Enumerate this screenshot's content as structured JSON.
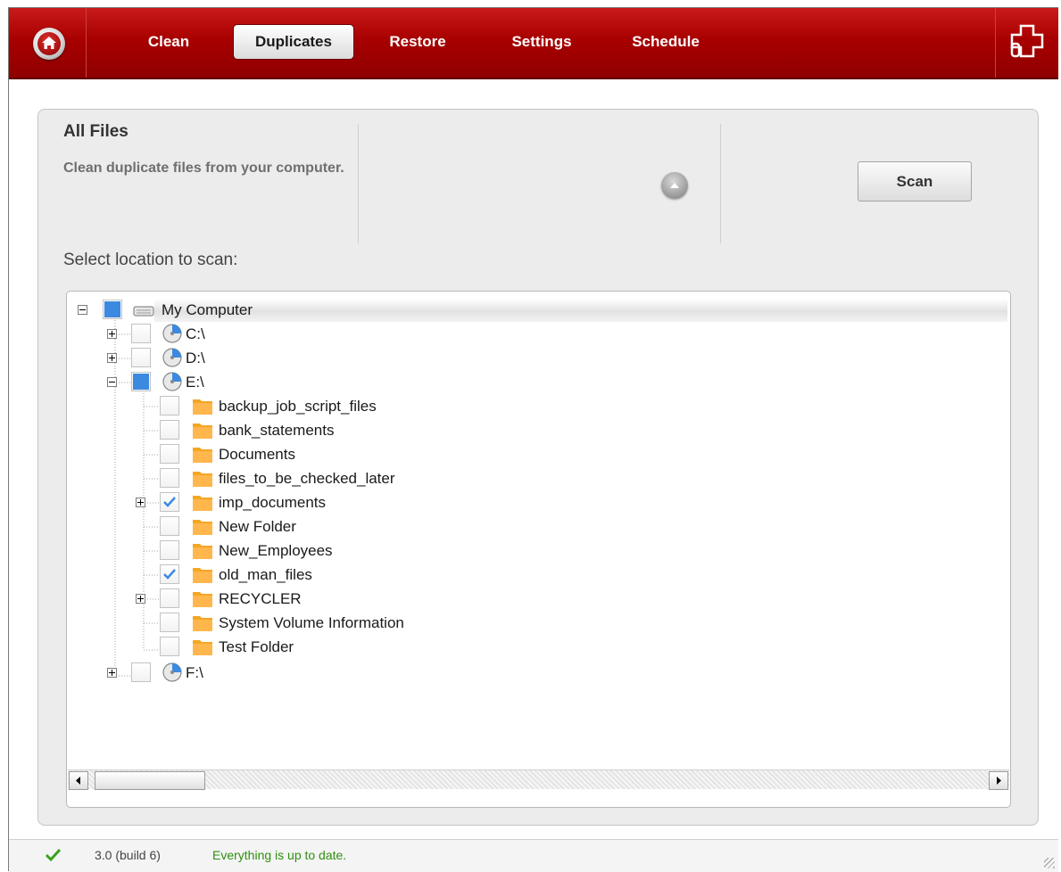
{
  "nav": {
    "tabs": [
      {
        "label": "Clean"
      },
      {
        "label": "Duplicates"
      },
      {
        "label": "Restore"
      },
      {
        "label": "Settings"
      },
      {
        "label": "Schedule"
      }
    ],
    "active_tab": "Duplicates"
  },
  "panel": {
    "title": "All Files",
    "description": "Clean duplicate files from your computer.",
    "scan_label": "Scan",
    "select_label": "Select location to scan:"
  },
  "tree": {
    "root": {
      "label": "My Computer",
      "state": "partial",
      "expanded": true
    },
    "drives": [
      {
        "label": "C:\\",
        "state": "unchecked",
        "expanded": false
      },
      {
        "label": "D:\\",
        "state": "unchecked",
        "expanded": false
      },
      {
        "label": "E:\\",
        "state": "partial",
        "expanded": true
      },
      {
        "label": "F:\\",
        "state": "unchecked",
        "expanded": false
      }
    ],
    "folders": [
      {
        "label": "backup_job_script_files",
        "state": "unchecked",
        "has_children": false
      },
      {
        "label": "bank_statements",
        "state": "unchecked",
        "has_children": false
      },
      {
        "label": "Documents",
        "state": "unchecked",
        "has_children": false
      },
      {
        "label": "files_to_be_checked_later",
        "state": "unchecked",
        "has_children": false
      },
      {
        "label": "imp_documents",
        "state": "checked",
        "has_children": true
      },
      {
        "label": "New Folder",
        "state": "unchecked",
        "has_children": false
      },
      {
        "label": "New_Employees",
        "state": "unchecked",
        "has_children": false
      },
      {
        "label": "old_man_files",
        "state": "checked",
        "has_children": false
      },
      {
        "label": "RECYCLER",
        "state": "unchecked",
        "has_children": true
      },
      {
        "label": "System Volume Information",
        "state": "unchecked",
        "has_children": false
      },
      {
        "label": "Test Folder",
        "state": "unchecked",
        "has_children": false
      }
    ]
  },
  "status": {
    "version": "3.0 (build 6)",
    "message": "Everything is up to date."
  },
  "colors": {
    "topbar": "#a80000",
    "checkbox_fill": "#3b8ae0",
    "folder": "#f5a623",
    "status_ok": "#2f8f10"
  }
}
